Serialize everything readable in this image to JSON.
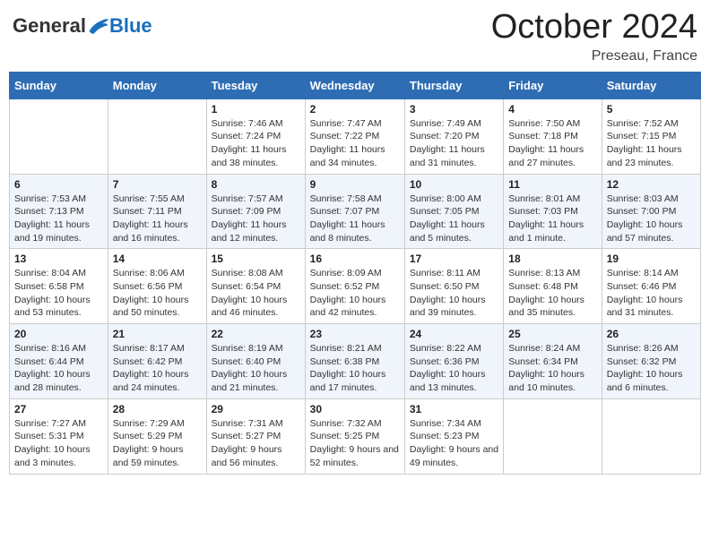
{
  "header": {
    "logo": {
      "general": "General",
      "blue": "Blue"
    },
    "title": "October 2024",
    "location": "Preseau, France"
  },
  "calendar": {
    "days_of_week": [
      "Sunday",
      "Monday",
      "Tuesday",
      "Wednesday",
      "Thursday",
      "Friday",
      "Saturday"
    ],
    "weeks": [
      [
        {
          "day": "",
          "info": ""
        },
        {
          "day": "",
          "info": ""
        },
        {
          "day": "1",
          "info": "Sunrise: 7:46 AM\nSunset: 7:24 PM\nDaylight: 11 hours and 38 minutes."
        },
        {
          "day": "2",
          "info": "Sunrise: 7:47 AM\nSunset: 7:22 PM\nDaylight: 11 hours and 34 minutes."
        },
        {
          "day": "3",
          "info": "Sunrise: 7:49 AM\nSunset: 7:20 PM\nDaylight: 11 hours and 31 minutes."
        },
        {
          "day": "4",
          "info": "Sunrise: 7:50 AM\nSunset: 7:18 PM\nDaylight: 11 hours and 27 minutes."
        },
        {
          "day": "5",
          "info": "Sunrise: 7:52 AM\nSunset: 7:15 PM\nDaylight: 11 hours and 23 minutes."
        }
      ],
      [
        {
          "day": "6",
          "info": "Sunrise: 7:53 AM\nSunset: 7:13 PM\nDaylight: 11 hours and 19 minutes."
        },
        {
          "day": "7",
          "info": "Sunrise: 7:55 AM\nSunset: 7:11 PM\nDaylight: 11 hours and 16 minutes."
        },
        {
          "day": "8",
          "info": "Sunrise: 7:57 AM\nSunset: 7:09 PM\nDaylight: 11 hours and 12 minutes."
        },
        {
          "day": "9",
          "info": "Sunrise: 7:58 AM\nSunset: 7:07 PM\nDaylight: 11 hours and 8 minutes."
        },
        {
          "day": "10",
          "info": "Sunrise: 8:00 AM\nSunset: 7:05 PM\nDaylight: 11 hours and 5 minutes."
        },
        {
          "day": "11",
          "info": "Sunrise: 8:01 AM\nSunset: 7:03 PM\nDaylight: 11 hours and 1 minute."
        },
        {
          "day": "12",
          "info": "Sunrise: 8:03 AM\nSunset: 7:00 PM\nDaylight: 10 hours and 57 minutes."
        }
      ],
      [
        {
          "day": "13",
          "info": "Sunrise: 8:04 AM\nSunset: 6:58 PM\nDaylight: 10 hours and 53 minutes."
        },
        {
          "day": "14",
          "info": "Sunrise: 8:06 AM\nSunset: 6:56 PM\nDaylight: 10 hours and 50 minutes."
        },
        {
          "day": "15",
          "info": "Sunrise: 8:08 AM\nSunset: 6:54 PM\nDaylight: 10 hours and 46 minutes."
        },
        {
          "day": "16",
          "info": "Sunrise: 8:09 AM\nSunset: 6:52 PM\nDaylight: 10 hours and 42 minutes."
        },
        {
          "day": "17",
          "info": "Sunrise: 8:11 AM\nSunset: 6:50 PM\nDaylight: 10 hours and 39 minutes."
        },
        {
          "day": "18",
          "info": "Sunrise: 8:13 AM\nSunset: 6:48 PM\nDaylight: 10 hours and 35 minutes."
        },
        {
          "day": "19",
          "info": "Sunrise: 8:14 AM\nSunset: 6:46 PM\nDaylight: 10 hours and 31 minutes."
        }
      ],
      [
        {
          "day": "20",
          "info": "Sunrise: 8:16 AM\nSunset: 6:44 PM\nDaylight: 10 hours and 28 minutes."
        },
        {
          "day": "21",
          "info": "Sunrise: 8:17 AM\nSunset: 6:42 PM\nDaylight: 10 hours and 24 minutes."
        },
        {
          "day": "22",
          "info": "Sunrise: 8:19 AM\nSunset: 6:40 PM\nDaylight: 10 hours and 21 minutes."
        },
        {
          "day": "23",
          "info": "Sunrise: 8:21 AM\nSunset: 6:38 PM\nDaylight: 10 hours and 17 minutes."
        },
        {
          "day": "24",
          "info": "Sunrise: 8:22 AM\nSunset: 6:36 PM\nDaylight: 10 hours and 13 minutes."
        },
        {
          "day": "25",
          "info": "Sunrise: 8:24 AM\nSunset: 6:34 PM\nDaylight: 10 hours and 10 minutes."
        },
        {
          "day": "26",
          "info": "Sunrise: 8:26 AM\nSunset: 6:32 PM\nDaylight: 10 hours and 6 minutes."
        }
      ],
      [
        {
          "day": "27",
          "info": "Sunrise: 7:27 AM\nSunset: 5:31 PM\nDaylight: 10 hours and 3 minutes."
        },
        {
          "day": "28",
          "info": "Sunrise: 7:29 AM\nSunset: 5:29 PM\nDaylight: 9 hours and 59 minutes."
        },
        {
          "day": "29",
          "info": "Sunrise: 7:31 AM\nSunset: 5:27 PM\nDaylight: 9 hours and 56 minutes."
        },
        {
          "day": "30",
          "info": "Sunrise: 7:32 AM\nSunset: 5:25 PM\nDaylight: 9 hours and 52 minutes."
        },
        {
          "day": "31",
          "info": "Sunrise: 7:34 AM\nSunset: 5:23 PM\nDaylight: 9 hours and 49 minutes."
        },
        {
          "day": "",
          "info": ""
        },
        {
          "day": "",
          "info": ""
        }
      ]
    ]
  }
}
